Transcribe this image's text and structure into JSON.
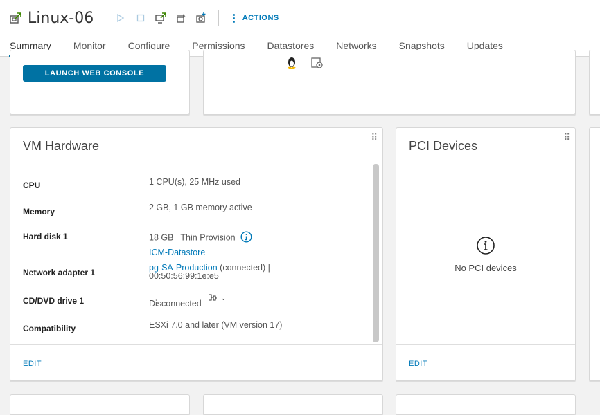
{
  "header": {
    "vm_name": "Linux-06",
    "actions_label": "ACTIONS",
    "toolbar_icons": [
      "power-on-icon",
      "power-off-icon",
      "launch-console-icon",
      "migrate-icon",
      "snapshot-icon"
    ]
  },
  "tabs": [
    {
      "label": "Summary",
      "active": true
    },
    {
      "label": "Monitor"
    },
    {
      "label": "Configure"
    },
    {
      "label": "Permissions"
    },
    {
      "label": "Datastores"
    },
    {
      "label": "Networks"
    },
    {
      "label": "Snapshots"
    },
    {
      "label": "Updates"
    }
  ],
  "console_card": {
    "launch_label": "LAUNCH WEB CONSOLE"
  },
  "vm_hardware": {
    "title": "VM Hardware",
    "rows": {
      "cpu": {
        "label": "CPU",
        "value": "1 CPU(s), 25 MHz used"
      },
      "memory": {
        "label": "Memory",
        "value": "2 GB, 1 GB memory active"
      },
      "hard_disk": {
        "label": "Hard disk 1",
        "value": "18 GB | Thin Provision",
        "datastore": "ICM-Datastore"
      },
      "network": {
        "label": "Network adapter 1",
        "network_name": "pg-SA-Production",
        "status": "(connected) |",
        "mac": "00:50:56:99:1e:e5"
      },
      "cdrom": {
        "label": "CD/DVD drive 1",
        "value": "Disconnected"
      },
      "compat": {
        "label": "Compatibility",
        "value": "ESXi 7.0 and later (VM version 17)"
      }
    },
    "edit_label": "EDIT"
  },
  "pci_devices": {
    "title": "PCI Devices",
    "empty_text": "No PCI devices",
    "edit_label": "EDIT"
  },
  "colors": {
    "accent": "#0072a3",
    "link": "#0079b8"
  }
}
